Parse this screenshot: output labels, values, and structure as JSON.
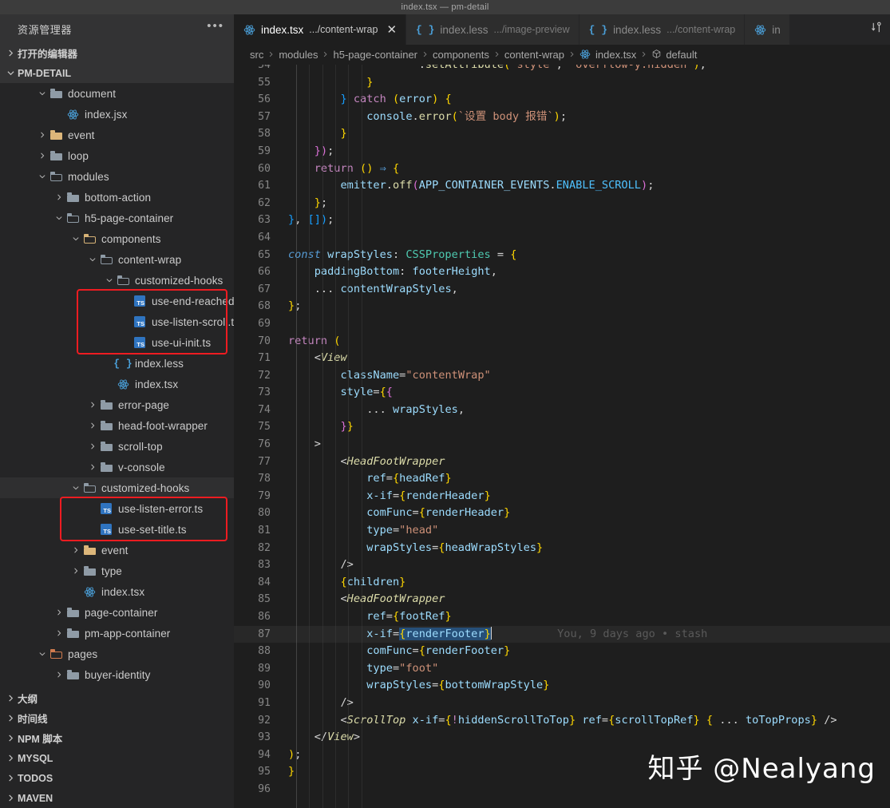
{
  "titlebar": {
    "title": "index.tsx — pm-detail"
  },
  "sidebar": {
    "header": {
      "label": "资源管理器",
      "more_icon": "ellipsis-icon"
    },
    "open_editors": {
      "label": "打开的编辑器"
    },
    "project": {
      "label": "PM-DETAIL"
    },
    "tree": [
      {
        "indent": 2,
        "arrow": "down",
        "icon": "folder-open-icon",
        "label": "document",
        "kind": "folder"
      },
      {
        "indent": 3,
        "arrow": "none",
        "icon": "react-icon",
        "label": "index.jsx",
        "kind": "react"
      },
      {
        "indent": 2,
        "arrow": "right",
        "icon": "folder-icon",
        "label": "event",
        "kind": "folder-yellow"
      },
      {
        "indent": 2,
        "arrow": "right",
        "icon": "folder-icon",
        "label": "loop",
        "kind": "folder"
      },
      {
        "indent": 2,
        "arrow": "down",
        "icon": "folder-open-icon",
        "label": "modules",
        "kind": "folder-open"
      },
      {
        "indent": 3,
        "arrow": "right",
        "icon": "folder-icon",
        "label": "bottom-action",
        "kind": "folder"
      },
      {
        "indent": 3,
        "arrow": "down",
        "icon": "folder-open-icon",
        "label": "h5-page-container",
        "kind": "folder-open"
      },
      {
        "indent": 4,
        "arrow": "down",
        "icon": "folder-open-icon",
        "label": "components",
        "kind": "folder-comp"
      },
      {
        "indent": 5,
        "arrow": "down",
        "icon": "folder-open-icon",
        "label": "content-wrap",
        "kind": "folder-open"
      },
      {
        "indent": 6,
        "arrow": "down",
        "icon": "folder-open-icon",
        "label": "customized-hooks",
        "kind": "folder-open"
      },
      {
        "indent": 7,
        "arrow": "none",
        "icon": "typescript-icon",
        "label": "use-end-reached.ts",
        "kind": "ts"
      },
      {
        "indent": 7,
        "arrow": "none",
        "icon": "typescript-icon",
        "label": "use-listen-scroll.ts",
        "kind": "ts"
      },
      {
        "indent": 7,
        "arrow": "none",
        "icon": "typescript-icon",
        "label": "use-ui-init.ts",
        "kind": "ts"
      },
      {
        "indent": 6,
        "arrow": "none",
        "icon": "less-icon",
        "label": "index.less",
        "kind": "less"
      },
      {
        "indent": 6,
        "arrow": "none",
        "icon": "react-icon",
        "label": "index.tsx",
        "kind": "react"
      },
      {
        "indent": 5,
        "arrow": "right",
        "icon": "folder-icon",
        "label": "error-page",
        "kind": "folder"
      },
      {
        "indent": 5,
        "arrow": "right",
        "icon": "folder-icon",
        "label": "head-foot-wrapper",
        "kind": "folder"
      },
      {
        "indent": 5,
        "arrow": "right",
        "icon": "folder-icon",
        "label": "scroll-top",
        "kind": "folder"
      },
      {
        "indent": 5,
        "arrow": "right",
        "icon": "folder-icon",
        "label": "v-console",
        "kind": "folder"
      },
      {
        "indent": 4,
        "arrow": "down",
        "icon": "folder-open-icon",
        "label": "customized-hooks",
        "kind": "folder-open",
        "selected": true
      },
      {
        "indent": 5,
        "arrow": "none",
        "icon": "typescript-icon",
        "label": "use-listen-error.ts",
        "kind": "ts"
      },
      {
        "indent": 5,
        "arrow": "none",
        "icon": "typescript-icon",
        "label": "use-set-title.ts",
        "kind": "ts"
      },
      {
        "indent": 4,
        "arrow": "right",
        "icon": "folder-icon",
        "label": "event",
        "kind": "folder-yellow"
      },
      {
        "indent": 4,
        "arrow": "right",
        "icon": "folder-icon",
        "label": "type",
        "kind": "folder"
      },
      {
        "indent": 4,
        "arrow": "none",
        "icon": "react-icon",
        "label": "index.tsx",
        "kind": "react"
      },
      {
        "indent": 3,
        "arrow": "right",
        "icon": "folder-icon",
        "label": "page-container",
        "kind": "folder"
      },
      {
        "indent": 3,
        "arrow": "right",
        "icon": "folder-icon",
        "label": "pm-app-container",
        "kind": "folder"
      },
      {
        "indent": 2,
        "arrow": "down",
        "icon": "folder-open-icon",
        "label": "pages",
        "kind": "folder-pages"
      },
      {
        "indent": 3,
        "arrow": "right",
        "icon": "folder-icon",
        "label": "buyer-identity",
        "kind": "folder"
      }
    ],
    "bottom_sections": [
      {
        "label": "大纲"
      },
      {
        "label": "时间线"
      },
      {
        "label": "NPM 脚本"
      },
      {
        "label": "MYSQL"
      },
      {
        "label": "TODOS"
      },
      {
        "label": "MAVEN"
      }
    ]
  },
  "tabs": [
    {
      "icon": "react-icon",
      "name": "index.tsx",
      "sub": ".../content-wrap",
      "active": true,
      "closable": true
    },
    {
      "icon": "less-icon",
      "name": "index.less",
      "sub": ".../image-preview",
      "active": false,
      "closable": false
    },
    {
      "icon": "less-icon",
      "name": "index.less",
      "sub": ".../content-wrap",
      "active": false,
      "closable": false
    },
    {
      "icon": "react-icon",
      "name": "in",
      "sub": "",
      "active": false,
      "closable": false
    }
  ],
  "tabs_actions": {
    "split_icon": "split-editor-icon"
  },
  "breadcrumb": [
    {
      "label": "src",
      "icon": ""
    },
    {
      "label": "modules",
      "icon": ""
    },
    {
      "label": "h5-page-container",
      "icon": ""
    },
    {
      "label": "components",
      "icon": ""
    },
    {
      "label": "content-wrap",
      "icon": ""
    },
    {
      "label": "index.tsx",
      "icon": "react-icon"
    },
    {
      "label": "default",
      "icon": "symbol-default-icon"
    }
  ],
  "editor": {
    "first_line": 54,
    "last_line": 96,
    "highlight_line": 87,
    "blame": "You, 9 days ago • stash",
    "lines": {
      "54": ".setAttribute(\"style\", \"overflow-y:hidden\");",
      "55": "}",
      "56": "} catch (error) {",
      "57": "console.error(`设置 body 报错`);",
      "58": "}",
      "59": "});",
      "60": "return () ⇒ {",
      "61": "emitter.off(APP_CONTAINER_EVENTS.ENABLE_SCROLL);",
      "62": "};",
      "63": "}, []);",
      "64": "",
      "65": "const wrapStyles: CSSProperties = {",
      "66": "paddingBottom: footerHeight,",
      "67": "... contentWrapStyles,",
      "68": "};",
      "69": "",
      "70": "return (",
      "71": "<View",
      "72": "className=\"contentWrap\"",
      "73": "style={{",
      "74": "... wrapStyles,",
      "75": "}}",
      "76": ">",
      "77": "<HeadFootWrapper",
      "78": "ref={headRef}",
      "79": "x-if={renderHeader}",
      "80": "comFunc={renderHeader}",
      "81": "type=\"head\"",
      "82": "wrapStyles={headWrapStyles}",
      "83": "/>",
      "84": "{children}",
      "85": "<HeadFootWrapper",
      "86": "ref={footRef}",
      "87": "x-if={renderFooter}",
      "88": "comFunc={renderFooter}",
      "89": "type=\"foot\"",
      "90": "wrapStyles={bottomWrapStyle}",
      "91": "/>",
      "92": "<ScrollTop x-if={!hiddenScrollToTop} ref={scrollTopRef} { ... toTopProps} />",
      "93": "</View>",
      "94": ");",
      "95": "}",
      "96": ""
    }
  },
  "watermark": {
    "text": "知乎 @Nealyang"
  },
  "colors": {
    "sidebar_bg": "#252526",
    "editor_bg": "#1e1e1e",
    "tab_active_bg": "#1e1e1e",
    "tab_inactive_bg": "#2d2d2d",
    "titlebar_bg": "#3c3c3c",
    "annotation_red": "#ee1c21",
    "accent_blue": "#2f74c0"
  }
}
